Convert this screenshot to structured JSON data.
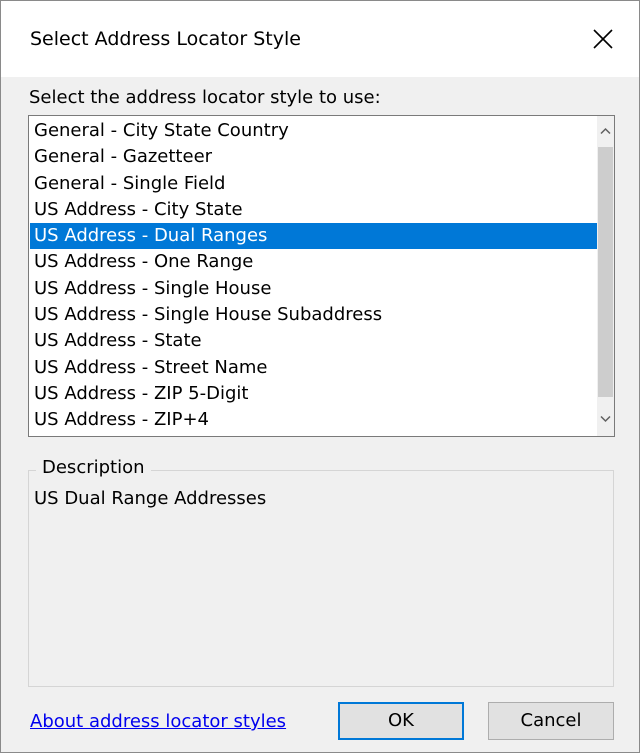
{
  "window": {
    "title": "Select Address Locator Style",
    "close_icon": "close-icon"
  },
  "prompt": {
    "label": "Select the address locator style to use:"
  },
  "locator_list": {
    "items": [
      "General - City State Country",
      "General - Gazetteer",
      "General - Single Field",
      "US Address - City State",
      "US Address - Dual Ranges",
      "US Address - One Range",
      "US Address - Single House",
      "US Address - Single House Subaddress",
      "US Address - State",
      "US Address - Street Name",
      "US Address - ZIP 5-Digit",
      "US Address - ZIP+4"
    ],
    "selected_index": 4,
    "selected_color": "#0078d7"
  },
  "description": {
    "legend": "Description",
    "text": "US Dual Range Addresses"
  },
  "footer": {
    "about_link": "About address locator styles",
    "ok_label": "OK",
    "cancel_label": "Cancel"
  }
}
